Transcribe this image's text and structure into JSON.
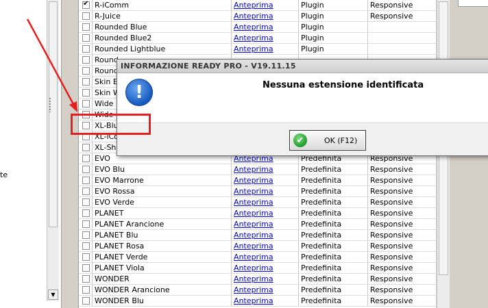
{
  "left_panel": {
    "partial_text": "te"
  },
  "grid": {
    "rows": [
      {
        "checked": true,
        "name": "R-iComm",
        "preview": "Anteprima",
        "type": "Plugin",
        "layout": "Responsive"
      },
      {
        "checked": false,
        "name": "R-Juice",
        "preview": "Anteprima",
        "type": "Plugin",
        "layout": "Responsive"
      },
      {
        "checked": false,
        "name": "Rounded Blue",
        "preview": "Anteprima",
        "type": "Plugin",
        "layout": ""
      },
      {
        "checked": false,
        "name": "Rounded Blue2",
        "preview": "Anteprima",
        "type": "Plugin",
        "layout": ""
      },
      {
        "checked": false,
        "name": "Rounded Lightblue",
        "preview": "Anteprima",
        "type": "Plugin",
        "layout": ""
      },
      {
        "checked": false,
        "name": "Round",
        "preview": "",
        "type": "",
        "layout": ""
      },
      {
        "checked": false,
        "name": "Round",
        "preview": "",
        "type": "",
        "layout": ""
      },
      {
        "checked": false,
        "name": "Skin EV",
        "preview": "",
        "type": "",
        "layout": ""
      },
      {
        "checked": false,
        "name": "Skin W",
        "preview": "",
        "type": "",
        "layout": ""
      },
      {
        "checked": false,
        "name": "Wide D",
        "preview": "",
        "type": "",
        "layout": ""
      },
      {
        "checked": false,
        "name": "Wide S",
        "preview": "",
        "type": "",
        "layout": ""
      },
      {
        "checked": false,
        "name": "XL-Blue",
        "preview": "",
        "type": "",
        "layout": ""
      },
      {
        "checked": false,
        "name": "XL-iCo",
        "preview": "",
        "type": "",
        "layout": ""
      },
      {
        "checked": false,
        "name": "XL-Sha",
        "preview": "",
        "type": "",
        "layout": ""
      },
      {
        "checked": false,
        "name": "EVO",
        "preview": "Anteprima",
        "type": "Predefinita",
        "layout": "Responsive"
      },
      {
        "checked": false,
        "name": "EVO Blu",
        "preview": "Anteprima",
        "type": "Predefinita",
        "layout": "Responsive"
      },
      {
        "checked": false,
        "name": "EVO Marrone",
        "preview": "Anteprima",
        "type": "Predefinita",
        "layout": "Responsive"
      },
      {
        "checked": false,
        "name": "EVO Rossa",
        "preview": "Anteprima",
        "type": "Predefinita",
        "layout": "Responsive"
      },
      {
        "checked": false,
        "name": "EVO Verde",
        "preview": "Anteprima",
        "type": "Predefinita",
        "layout": "Responsive"
      },
      {
        "checked": false,
        "name": "PLANET",
        "preview": "Anteprima",
        "type": "Predefinita",
        "layout": "Responsive"
      },
      {
        "checked": false,
        "name": "PLANET Arancione",
        "preview": "Anteprima",
        "type": "Predefinita",
        "layout": "Responsive"
      },
      {
        "checked": false,
        "name": "PLANET Blu",
        "preview": "Anteprima",
        "type": "Predefinita",
        "layout": "Responsive"
      },
      {
        "checked": false,
        "name": "PLANET Rosa",
        "preview": "Anteprima",
        "type": "Predefinita",
        "layout": "Responsive"
      },
      {
        "checked": false,
        "name": "PLANET Verde",
        "preview": "Anteprima",
        "type": "Predefinita",
        "layout": "Responsive"
      },
      {
        "checked": false,
        "name": "PLANET Viola",
        "preview": "Anteprima",
        "type": "Predefinita",
        "layout": "Responsive"
      },
      {
        "checked": false,
        "name": "WONDER",
        "preview": "Anteprima",
        "type": "Predefinita",
        "layout": "Responsive"
      },
      {
        "checked": false,
        "name": "WONDER Arancione",
        "preview": "Anteprima",
        "type": "Predefinita",
        "layout": "Responsive"
      },
      {
        "checked": false,
        "name": "WONDER Blu",
        "preview": "Anteprima",
        "type": "Predefinita",
        "layout": "Responsive"
      }
    ]
  },
  "dialog": {
    "title": "INFORMAZIONE READY PRO - V19.11.15",
    "message": "Nessuna estensione identificata",
    "ok_label": "OK (F12)",
    "info_icon": "info-exclamation-icon",
    "ok_icon": "check-icon"
  },
  "colors": {
    "annotation": "#e61e1e",
    "link": "#0000cc",
    "info_icon": "#1559c0",
    "ok_icon": "#1f9a2a"
  }
}
